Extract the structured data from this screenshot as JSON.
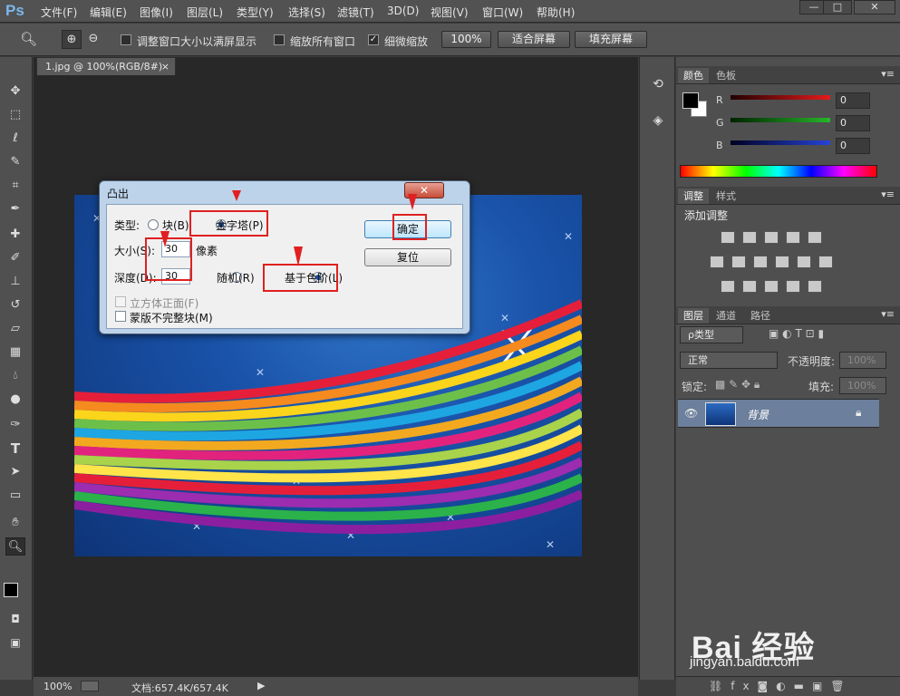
{
  "app": {
    "logo": "Ps"
  },
  "menu": [
    "文件(F)",
    "编辑(E)",
    "图像(I)",
    "图层(L)",
    "类型(Y)",
    "选择(S)",
    "滤镜(T)",
    "3D(D)",
    "视图(V)",
    "窗口(W)",
    "帮助(H)"
  ],
  "window_controls": {
    "minimize": "—",
    "maximize": "□",
    "close": "✕"
  },
  "options": {
    "resize_windows_label": "调整窗口大小以满屏显示",
    "zoom_all_label": "缩放所有窗口",
    "scrubby_zoom_label": "细微缩放",
    "zoom_100_label": "100%",
    "fit_screen_label": "适合屏幕",
    "fill_screen_label": "填充屏幕",
    "resize_windows_checked": false,
    "zoom_all_checked": false,
    "scrubby_zoom_checked": true
  },
  "document": {
    "tab_title": "1.jpg @ 100%(RGB/8#)",
    "tab_close": "×"
  },
  "status": {
    "zoom": "100%",
    "doc_info": "文档:657.4K/657.4K"
  },
  "panels": {
    "color": {
      "tabs": [
        "颜色",
        "色板"
      ],
      "r_label": "R",
      "g_label": "G",
      "b_label": "B",
      "r_value": "0",
      "g_value": "0",
      "b_value": "0",
      "r_color": "#e11b1b",
      "g_color": "#27b52b",
      "b_color": "#2543d8"
    },
    "adjustments": {
      "tabs": [
        "调整",
        "样式"
      ],
      "heading": "添加调整"
    },
    "layers": {
      "tabs": [
        "图层",
        "通道",
        "路径"
      ],
      "filter_label": "ρ类型",
      "blend_mode": "正常",
      "opacity_label": "不透明度:",
      "opacity_value": "100%",
      "lock_label": "锁定:",
      "fill_label": "填充:",
      "fill_value": "100%",
      "layer_name": "背景"
    }
  },
  "dialog": {
    "title": "凸出",
    "close": "✕",
    "type_label": "类型:",
    "type_block": "块(B)",
    "type_pyramid": "金字塔(P)",
    "size_label": "大小(S):",
    "size_value": "30",
    "size_unit": "像素",
    "depth_label": "深度(D):",
    "depth_value": "30",
    "depth_random": "随机(R)",
    "depth_level": "基于色阶(L)",
    "solid_front": "立方体正面(F)",
    "mask_incomplete": "蒙版不完整块(M)",
    "ok": "确定",
    "cancel": "复位"
  },
  "watermark": {
    "brand": "Bai 经验",
    "url": "jingyan.baidu.com"
  }
}
